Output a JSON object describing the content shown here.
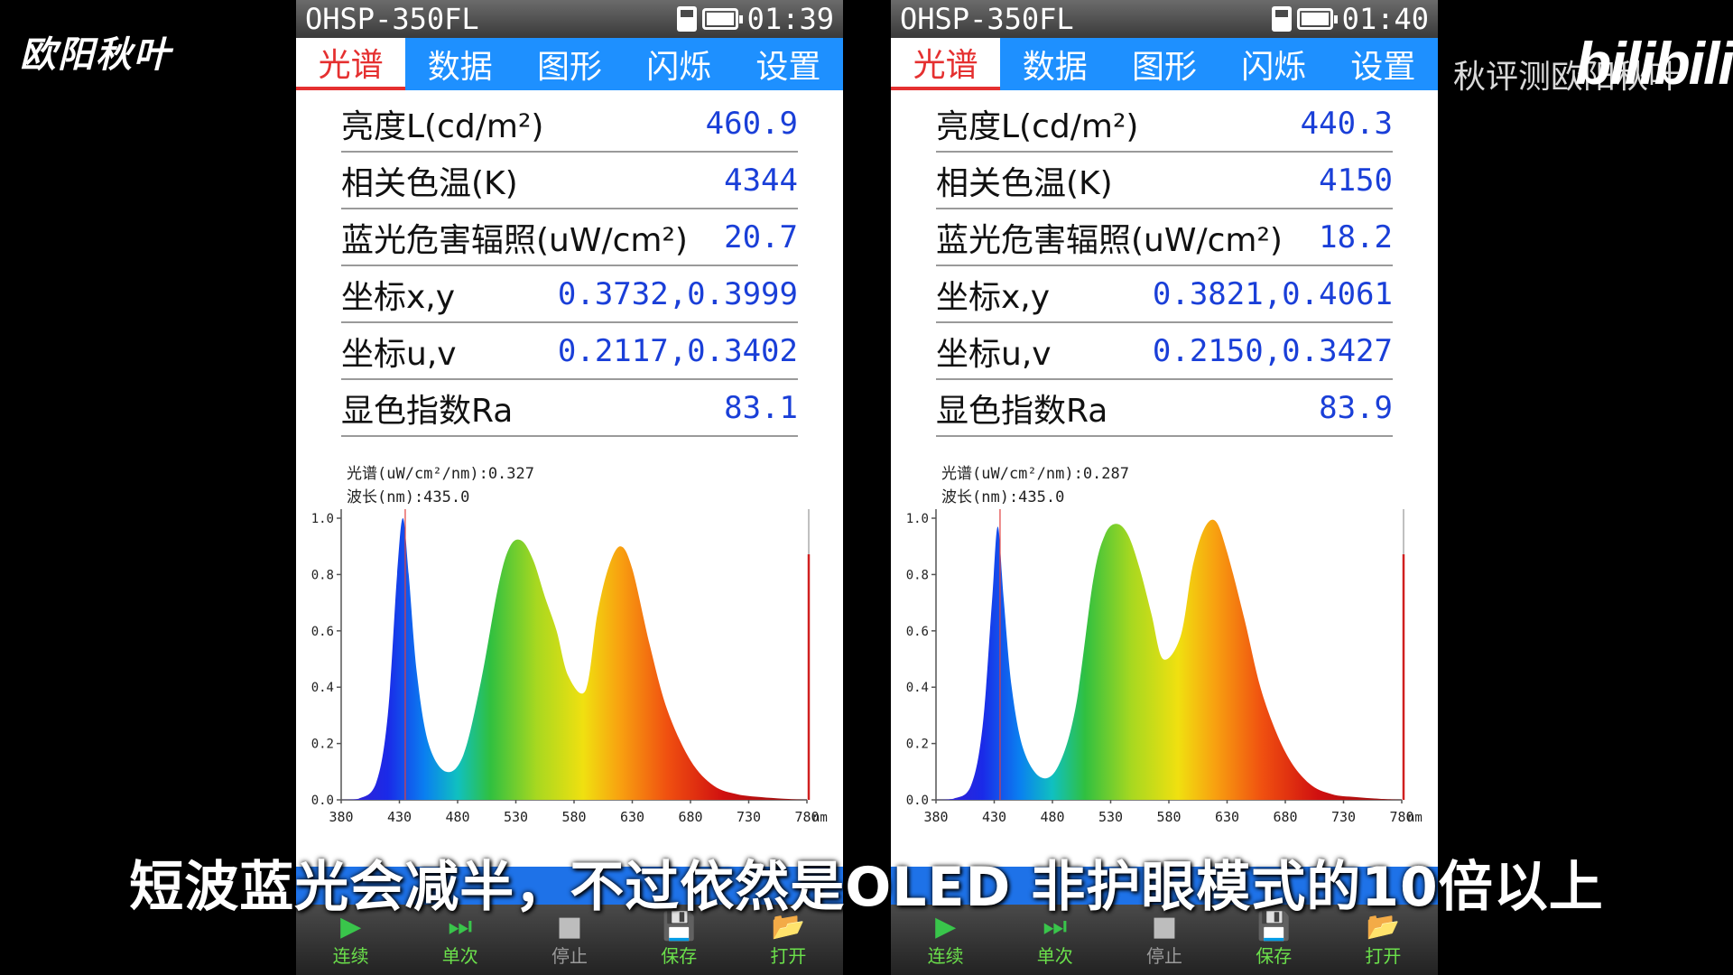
{
  "watermarks": {
    "author_left": "欧阳秋叶",
    "author_right": "欧阳秋叶",
    "overlay_right": "秋评测",
    "platform": "bilibili"
  },
  "subtitle": "短波蓝光会减半，不过依然是OLED 非护眼模式的10倍以上",
  "colors": {
    "tab_bar": "#1e90ff",
    "active_tab": "#e53030",
    "value_text": "#1a3fd8",
    "tool_green": "#39c54b"
  },
  "chart_axes": {
    "x_ticks": [
      "380",
      "430",
      "480",
      "530",
      "580",
      "630",
      "680",
      "730",
      "780"
    ],
    "x_unit": "nm",
    "y_ticks": [
      "1.0",
      "0.8",
      "0.6",
      "0.4",
      "0.2",
      "0.0"
    ]
  },
  "devices": [
    {
      "model": "OHSP-350FL",
      "time": "01:39",
      "tabs": [
        "光谱",
        "数据",
        "图形",
        "闪烁",
        "设置"
      ],
      "readings": [
        {
          "label": "亮度L(cd/m²)",
          "value": "460.9"
        },
        {
          "label": "相关色温(K)",
          "value": "4344"
        },
        {
          "label": "蓝光危害辐照(uW/cm²)",
          "value": "20.7"
        },
        {
          "label": "坐标x,y",
          "value": "0.3732,0.3999"
        },
        {
          "label": "坐标u,v",
          "value": "0.2117,0.3402"
        },
        {
          "label": "显色指数Ra",
          "value": "83.1"
        }
      ],
      "spectrum_readout": "光谱(uW/cm²/nm):0.327",
      "wavelength_readout": "波长(nm):435.0",
      "chart_data": {
        "type": "area",
        "x": [
          380,
          395,
          410,
          420,
          428,
          433,
          438,
          445,
          455,
          470,
          485,
          500,
          515,
          525,
          535,
          545,
          555,
          565,
          575,
          590,
          600,
          610,
          620,
          630,
          645,
          660,
          680,
          700,
          720,
          740,
          760,
          780
        ],
        "y": [
          0,
          0.004,
          0.06,
          0.3,
          0.8,
          1.0,
          0.8,
          0.45,
          0.2,
          0.1,
          0.16,
          0.42,
          0.76,
          0.9,
          0.92,
          0.85,
          0.72,
          0.6,
          0.44,
          0.39,
          0.66,
          0.83,
          0.9,
          0.82,
          0.55,
          0.32,
          0.14,
          0.05,
          0.02,
          0.01,
          0.004,
          0
        ],
        "xlim": [
          380,
          780
        ],
        "ylim": [
          0,
          1.0
        ]
      }
    },
    {
      "model": "OHSP-350FL",
      "time": "01:40",
      "tabs": [
        "光谱",
        "数据",
        "图形",
        "闪烁",
        "设置"
      ],
      "readings": [
        {
          "label": "亮度L(cd/m²)",
          "value": "440.3"
        },
        {
          "label": "相关色温(K)",
          "value": "4150"
        },
        {
          "label": "蓝光危害辐照(uW/cm²)",
          "value": "18.2"
        },
        {
          "label": "坐标x,y",
          "value": "0.3821,0.4061"
        },
        {
          "label": "坐标u,v",
          "value": "0.2150,0.3427"
        },
        {
          "label": "显色指数Ra",
          "value": "83.9"
        }
      ],
      "spectrum_readout": "光谱(uW/cm²/nm):0.287",
      "wavelength_readout": "波长(nm):435.0",
      "chart_data": {
        "type": "area",
        "x": [
          380,
          395,
          410,
          420,
          428,
          433,
          438,
          445,
          455,
          470,
          485,
          500,
          515,
          525,
          535,
          545,
          555,
          565,
          575,
          590,
          600,
          610,
          620,
          630,
          645,
          660,
          680,
          700,
          720,
          740,
          760,
          780
        ],
        "y": [
          0,
          0.004,
          0.05,
          0.26,
          0.7,
          0.97,
          0.72,
          0.4,
          0.18,
          0.08,
          0.12,
          0.33,
          0.78,
          0.94,
          0.98,
          0.94,
          0.82,
          0.66,
          0.5,
          0.58,
          0.82,
          0.96,
          0.99,
          0.88,
          0.64,
          0.38,
          0.17,
          0.06,
          0.02,
          0.01,
          0.004,
          0
        ],
        "xlim": [
          380,
          780
        ],
        "ylim": [
          0,
          1.0
        ]
      }
    }
  ],
  "toolbar": [
    {
      "label": "连续",
      "icon": "play-icon",
      "glyph": "▶",
      "enabled": true
    },
    {
      "label": "单次",
      "icon": "step-icon",
      "glyph": "⏭",
      "enabled": true
    },
    {
      "label": "停止",
      "icon": "stop-icon",
      "glyph": "■",
      "enabled": false
    },
    {
      "label": "保存",
      "icon": "save-icon",
      "glyph": "💾",
      "enabled": true
    },
    {
      "label": "打开",
      "icon": "open-folder-icon",
      "glyph": "📂",
      "enabled": true
    }
  ]
}
